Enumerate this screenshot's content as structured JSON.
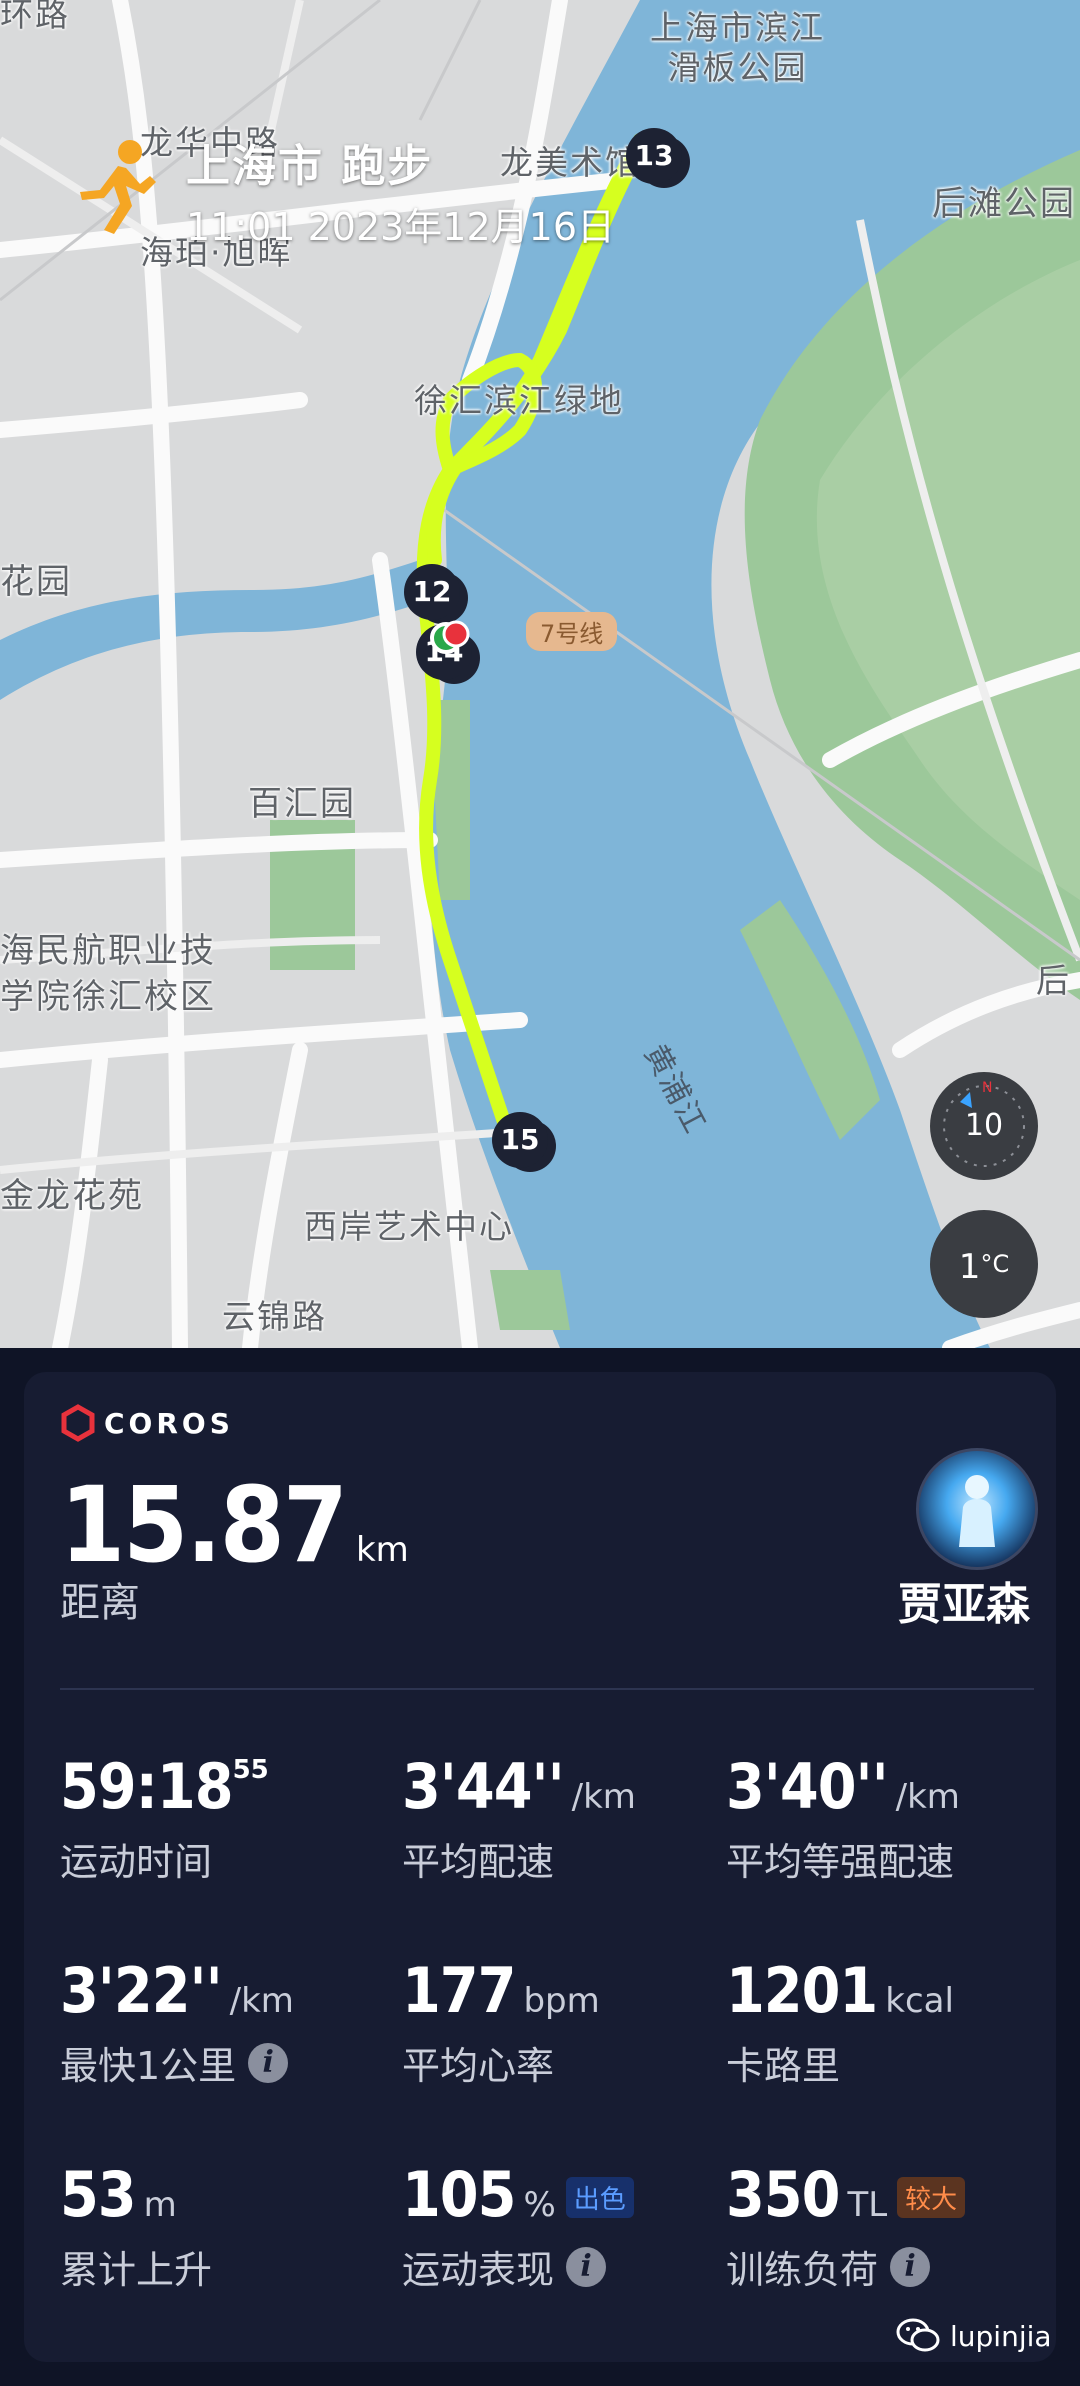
{
  "map": {
    "activity_title": "上海市 跑步",
    "activity_time": "11:01 2023年12月16日",
    "labels": {
      "top_left_cut": "环路",
      "skate_park": "上海市滨江\n滑板公园",
      "longhua_rd": "龙华中路",
      "art_museum": "龙美术馆",
      "haibin": "海珀·旭晖",
      "houtan_park": "后滩公园",
      "xuhui_greenland": "徐汇滨江绿地",
      "garden_left": "花园",
      "baihuiyuan": "百汇园",
      "college": "海民航职业技\n学院徐汇校区",
      "jinlong": "金龙花苑",
      "westbank": "西岸艺术中心",
      "yunjin_rd": "云锦路",
      "right_cut": "后",
      "river": "黄浦江",
      "metro": "7号线"
    },
    "km_markers": [
      "13",
      "12",
      "14",
      "15"
    ],
    "compass_value": "10",
    "temperature": "1",
    "temperature_unit": "°C"
  },
  "card": {
    "brand": "COROS",
    "distance": "15.87",
    "distance_unit": "km",
    "distance_label": "距离",
    "username": "贾亚森",
    "stats": [
      {
        "value": "59:18",
        "sup": "55",
        "unit": "",
        "label": "运动时间"
      },
      {
        "value": "3'44''",
        "unit": "/km",
        "label": "平均配速"
      },
      {
        "value": "3'40''",
        "unit": "/km",
        "label": "平均等强配速"
      },
      {
        "value": "3'22''",
        "unit": "/km",
        "label": "最快1公里"
      },
      {
        "value": "177",
        "unit": "bpm",
        "label": "平均心率"
      },
      {
        "value": "1201",
        "unit": "kcal",
        "label": "卡路里"
      },
      {
        "value": "53",
        "unit": "m",
        "label": "累计上升"
      },
      {
        "value": "105",
        "unit": "%",
        "tag": "出色",
        "label": "运动表现"
      },
      {
        "value": "350",
        "unit": "TL",
        "tag": "较大",
        "label": "训练负荷"
      }
    ]
  },
  "watermark": "lupinjia"
}
